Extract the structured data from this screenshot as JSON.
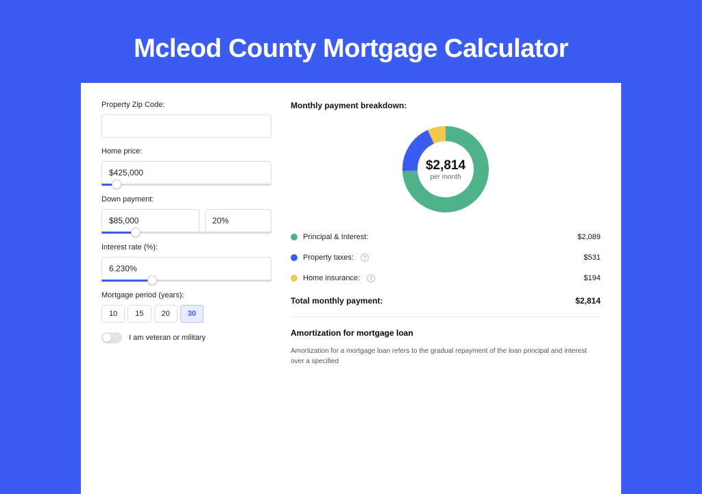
{
  "page_title": "Mcleod County Mortgage Calculator",
  "form": {
    "zip_label": "Property Zip Code:",
    "zip_value": "",
    "home_price_label": "Home price:",
    "home_price_value": "$425,000",
    "down_payment_label": "Down payment:",
    "down_payment_value": "$85,000",
    "down_payment_pct": "20%",
    "interest_label": "Interest rate (%):",
    "interest_value": "6.230%",
    "period_label": "Mortgage period (years):",
    "periods": [
      "10",
      "15",
      "20",
      "30"
    ],
    "period_selected": "30",
    "veteran_label": "I am veteran or military"
  },
  "breakdown": {
    "title": "Monthly payment breakdown:",
    "amount": "$2,814",
    "per_month": "per month",
    "items": [
      {
        "label": "Principal & Interest:",
        "value": "$2,089",
        "color": "green",
        "info": false
      },
      {
        "label": "Property taxes:",
        "value": "$531",
        "color": "blue",
        "info": true
      },
      {
        "label": "Home insurance:",
        "value": "$194",
        "color": "yellow",
        "info": true
      }
    ],
    "total_label": "Total monthly payment:",
    "total_value": "$2,814"
  },
  "amortization": {
    "title": "Amortization for mortgage loan",
    "text": "Amortization for a mortgage loan refers to the gradual repayment of the loan principal and interest over a specified"
  },
  "chart_data": {
    "type": "pie",
    "title": "Monthly payment breakdown",
    "series": [
      {
        "name": "Principal & Interest",
        "value": 2089,
        "color": "#4fb28a"
      },
      {
        "name": "Property taxes",
        "value": 531,
        "color": "#3a5cf0"
      },
      {
        "name": "Home insurance",
        "value": 194,
        "color": "#f0c84f"
      }
    ],
    "total": 2814,
    "unit": "USD per month"
  }
}
